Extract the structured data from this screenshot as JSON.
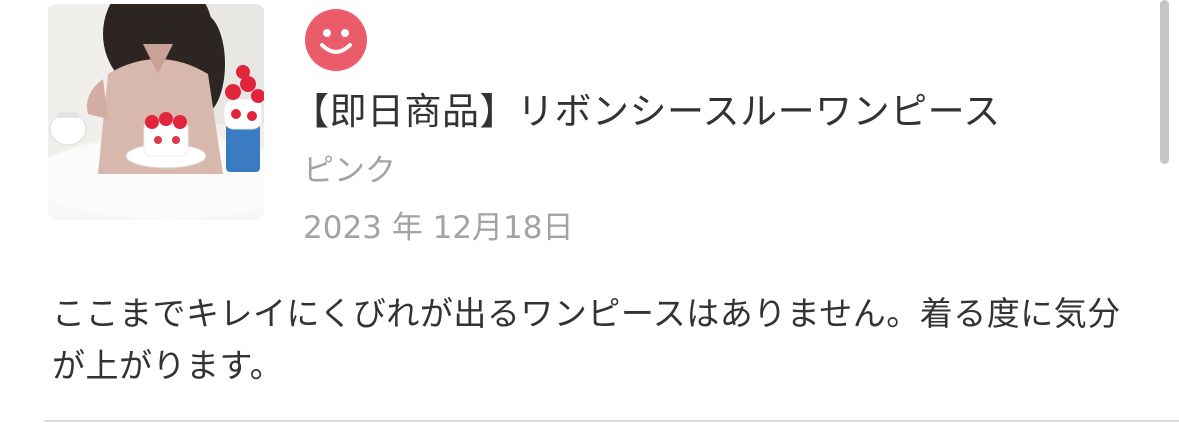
{
  "review": {
    "product_name": "【即日商品】リボンシースルーワンピース",
    "variant": "ピンク",
    "date": "2023 年 12月18日",
    "comment": "ここまでキレイにくびれが出るワンピースはありません。着る度に気分が上がります。",
    "rating_icon": "smiley-face-icon",
    "rating_color": "#eb5c6a"
  }
}
